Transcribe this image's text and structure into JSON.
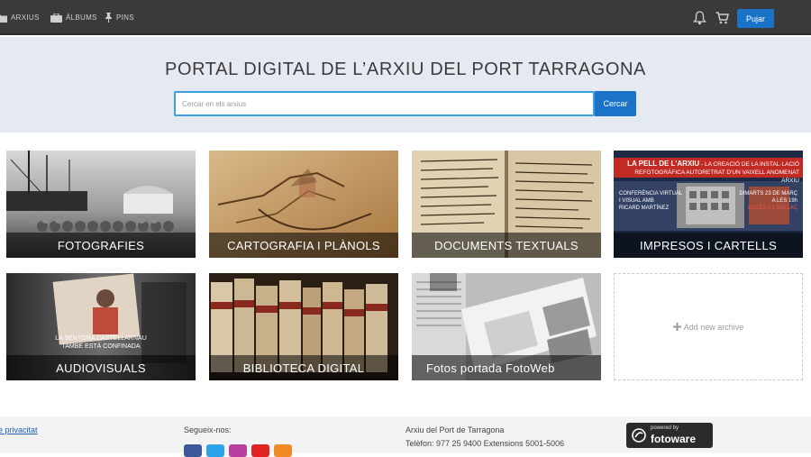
{
  "nav": {
    "items": [
      {
        "label": "ARXIUS",
        "icon": "folder-icon"
      },
      {
        "label": "ÀLBUMS",
        "icon": "briefcase-icon"
      },
      {
        "label": "PINS",
        "icon": "pin-icon"
      }
    ],
    "bell_icon": "bell-icon",
    "cart_icon": "cart-icon",
    "upload_label": "Pujar"
  },
  "hero": {
    "title": "PORTAL DIGITAL DE L’ARXIU DEL PORT TARRAGONA",
    "search_placeholder": "Cercar en els arxius",
    "search_button": "Cercar"
  },
  "archives": [
    {
      "label": "FOTOGRAFIES"
    },
    {
      "label": "CARTOGRAFIA I PLÀNOLS"
    },
    {
      "label": "DOCUMENTS TEXTUALS"
    },
    {
      "label": "IMPRESOS I CARTELLS"
    },
    {
      "label": "AUDIOVISUALS"
    },
    {
      "label": "BIBLIOTECA DIGITAL"
    },
    {
      "label": "Fotos portada FotoWeb"
    }
  ],
  "poster_impresos": {
    "headline": "LA PELL DE L'ARXIU",
    "sub": "- LA CREACIÓ DE LA INSTAL·LACIÓ",
    "sub2": "REFOTOGRÀFICA AUTORETRAT D'UN VAIXELL ANOMENAT ARXIU",
    "left1": "CONFERÈNCIA VIRTUAL",
    "left2": "I VISUAL AMB",
    "left3": "RICARD MARTÍNEZ",
    "right1": "DIMARTS 23 DE MARÇ",
    "right2": "A LES 19h",
    "right3": "ACCÉS A L'ENLLAÇ"
  },
  "poster_audio": {
    "line1": "LA SENYORA CASTELLARNAU",
    "line2": "TAMBÉ ESTÀ CONFINADA"
  },
  "add_archive_label": "Add new archive",
  "footer": {
    "privacy": "e privacitat",
    "follow": "Segueix-nos:",
    "org": "Arxiu del Port de Tarragona",
    "phone": "Telèfon: 977 25 9400 Extensions 5001-5006",
    "powered": "powered by",
    "brand": "fotoware"
  },
  "colors": {
    "nav_bg": "#3a3a3a",
    "accent": "#1a73c8",
    "hero_bg": "#e4e9f2",
    "poster_red": "#c22a24"
  }
}
